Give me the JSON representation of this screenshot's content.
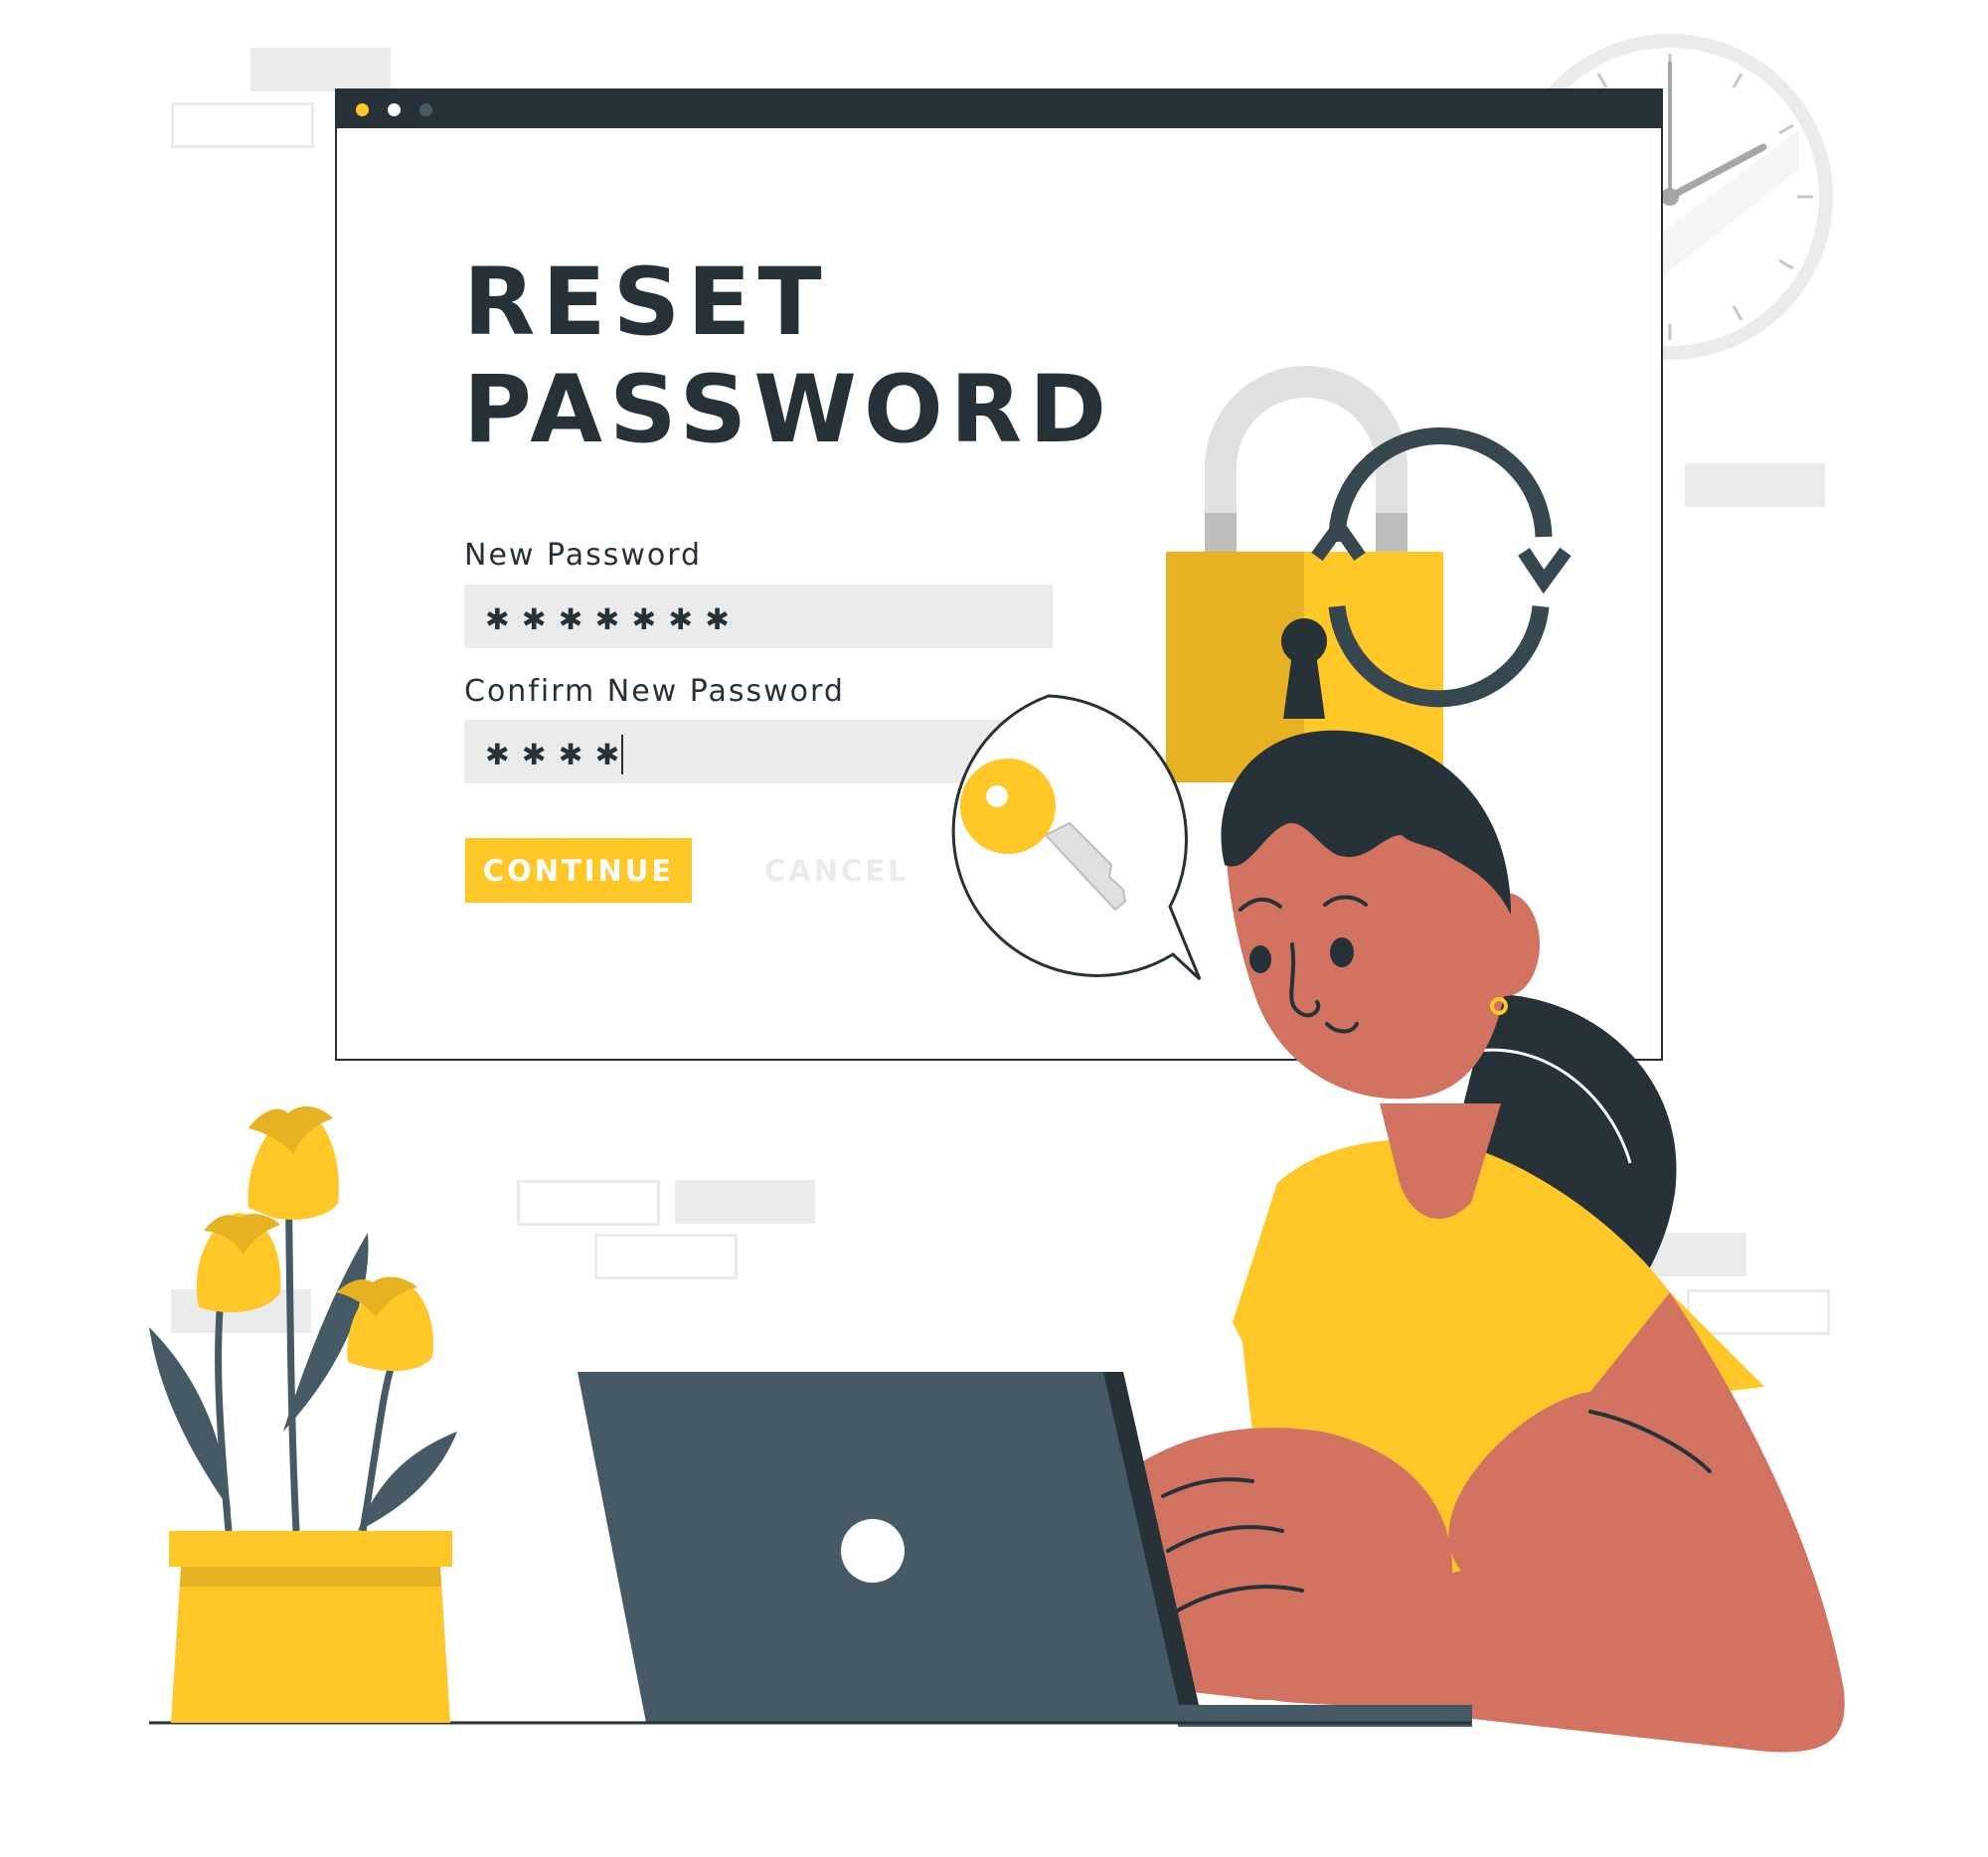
{
  "form": {
    "title_line1": "RESET",
    "title_line2": "PASSWORD",
    "new_password_label": "New Password",
    "new_password_value": "✱✱✱✱✱✱✱",
    "confirm_password_label": "Confirm New Password",
    "confirm_password_value": "✱✱✱✱",
    "continue_label": "CONTINUE",
    "cancel_label": "CANCEL"
  },
  "colors": {
    "accent": "#ffc727",
    "dark": "#263238",
    "laptop": "#455a64",
    "skin": "#d27361",
    "light_gray": "#ebebeb"
  },
  "icons": [
    "padlock-icon",
    "refresh-cycle-icon",
    "key-icon",
    "clock-icon"
  ]
}
